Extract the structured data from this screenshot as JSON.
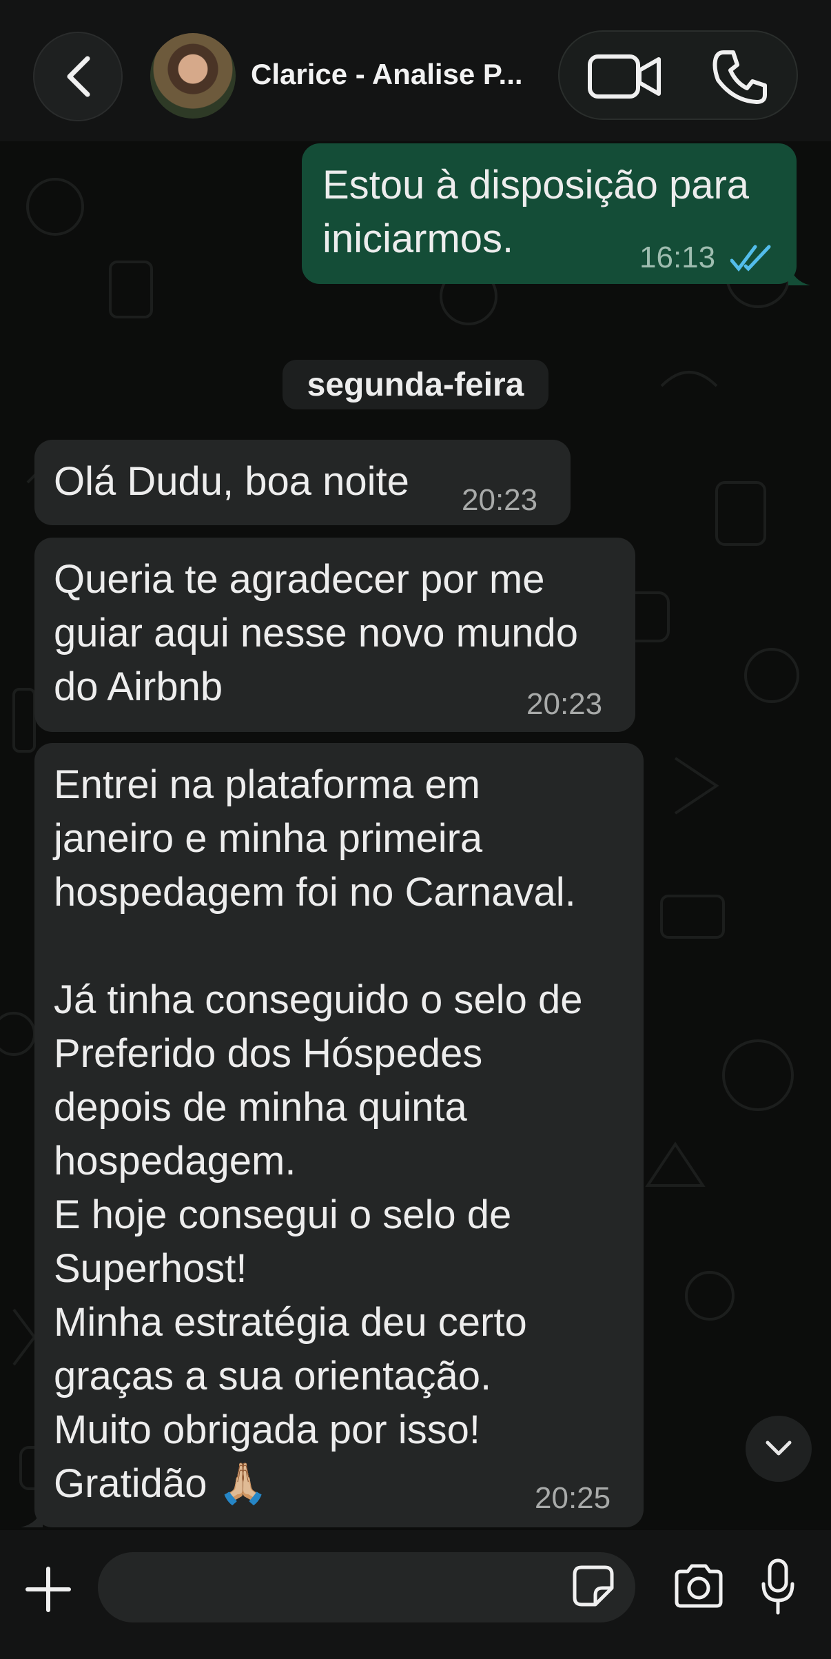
{
  "header": {
    "contact_name": "Clarice - Analise P...",
    "back_icon": "chevron-left-icon",
    "video_icon": "video-camera-icon",
    "call_icon": "phone-icon"
  },
  "messages": [
    {
      "direction": "out",
      "text": "Estou à disposição para\niniciarmos.",
      "time": "16:13",
      "status": "read"
    },
    {
      "direction": "in",
      "text": "Olá Dudu, boa noite",
      "time": "20:23"
    },
    {
      "direction": "in",
      "text": "Queria te agradecer por me\nguiar aqui nesse novo mundo\ndo Airbnb",
      "time": "20:23"
    },
    {
      "direction": "in",
      "text": "Entrei na plataforma em\njaneiro e minha primeira\nhospedagem foi no Carnaval.\n\nJá tinha conseguido o selo de\nPreferido dos Hóspedes\ndepois de minha quinta\nhospedagem.\nE hoje consegui o selo de\nSuperhost!\nMinha estratégia deu certo\ngraças a sua orientação.\nMuito obrigada por isso!\nGratidão 🙏🏼",
      "time": "20:25"
    }
  ],
  "date_separator": "segunda-feira",
  "composer": {
    "placeholder": "",
    "icons": [
      "plus-icon",
      "sticker-icon",
      "camera-icon",
      "microphone-icon"
    ]
  },
  "colors": {
    "outgoing_bubble": "#144d37",
    "incoming_bubble": "#242626",
    "read_ticks": "#53bdeb"
  }
}
